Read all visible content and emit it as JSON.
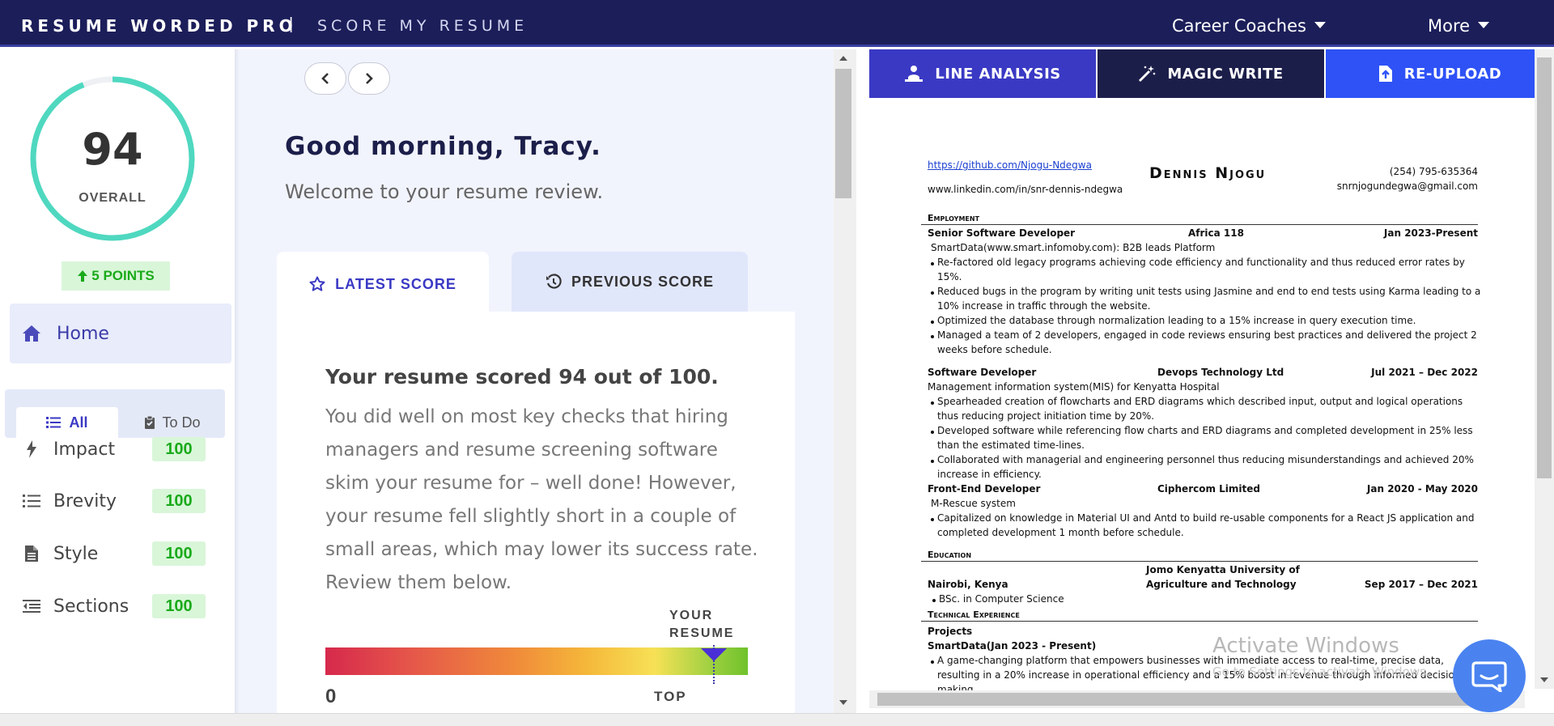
{
  "topbar": {
    "brand": "RESUME WORDED PRO",
    "separator": "|",
    "subtitle": "SCORE MY RESUME",
    "nav_career": "Career Coaches",
    "nav_more": "More"
  },
  "sidebar": {
    "score": "94",
    "score_label": "OVERALL",
    "score_progress": 0.94,
    "points": "5 POINTS",
    "home_label": "Home",
    "filter_all": "All",
    "filter_todo": "To Do",
    "categories": [
      {
        "label": "Impact",
        "score": "100",
        "icon": "lightning-icon"
      },
      {
        "label": "Brevity",
        "score": "100",
        "icon": "list-icon"
      },
      {
        "label": "Style",
        "score": "100",
        "icon": "document-icon"
      },
      {
        "label": "Sections",
        "score": "100",
        "icon": "sections-icon"
      }
    ]
  },
  "main": {
    "greeting": "Good morning, Tracy.",
    "welcome": "Welcome to your resume review.",
    "tab_latest": "LATEST SCORE",
    "tab_previous": "PREVIOUS SCORE",
    "card_title": "Your resume scored 94 out of 100.",
    "card_body": "You did well on most key checks that hiring managers and resume screening software skim your resume for – well done! However, your resume fell slightly short in a couple of small areas, which may lower its success rate. Review them below.",
    "your_resume_label_1": "YOUR",
    "your_resume_label_2": "RESUME",
    "bar_min": "0",
    "bar_top": "TOP",
    "bar_position": 0.92
  },
  "right": {
    "tab_line_analysis": "LINE ANALYSIS",
    "tab_magic_write": "MAGIC WRITE",
    "tab_reupload": "RE-UPLOAD",
    "colors": {
      "line_analysis": "#3a39c4",
      "magic_write": "#1c1e4a",
      "reupload": "#2e52f6"
    },
    "resume": {
      "github": "https://github.com/Njogu-Ndegwa",
      "linkedin": "www.linkedin.com/in/snr-dennis-ndegwa",
      "name": "Dennis Njogu",
      "phone": "(254) 795-635364",
      "email": "snrnjogundegwa@gmail.com",
      "employment_heading": "Employment",
      "job1_title": "Senior Software Developer",
      "job1_company": "Africa 118",
      "job1_dates": "Jan 2023-Present",
      "job1_sub": "SmartData(www.smart.infomoby.com): B2B leads Platform",
      "job1_b1a": "Re-factored old legacy programs achieving code efficiency and functionality and thus reduced error rates by",
      "job1_b1b": "15%.",
      "job1_b2a": "Reduced bugs in the program by writing unit tests using Jasmine and end to end tests using Karma leading to a",
      "job1_b2b": "10% increase in traffic through the website.",
      "job1_b3": "Optimized the database through normalization leading to a 15% increase in query execution time.",
      "job1_b4a": "Managed a team of 2 developers, engaged in code reviews ensuring best practices and delivered the project 2",
      "job1_b4b": "weeks before schedule.",
      "job2_title": "Software Developer",
      "job2_company": "Devops Technology Ltd",
      "job2_dates": "Jul 2021 – Dec 2022",
      "job2_sub": "Management information system(MIS) for Kenyatta Hospital",
      "job2_b1a": "Spearheaded creation of flowcharts and ERD diagrams which described input, output and logical operations",
      "job2_b1b": "thus reducing project initiation time by 20%.",
      "job2_b2a": "Developed software while referencing flow charts and ERD diagrams and completed development in 25% less",
      "job2_b2b": "than the estimated time-lines.",
      "job2_b3a": "Collaborated with managerial and engineering personnel thus reducing misunderstandings and achieved 20%",
      "job2_b3b": "increase in efficiency.",
      "job3_title": "Front-End Developer",
      "job3_company": "Ciphercom Limited",
      "job3_dates": "Jan 2020 - May 2020",
      "job3_sub": "M-Rescue system",
      "job3_b1a": "Capitalized on knowledge in Material UI and Antd to build re-usable components for a React JS application and",
      "job3_b1b": "completed development 1 month before schedule.",
      "education_heading": "Education",
      "edu_school_1": "Jomo Kenyatta University of",
      "edu_school_2": "Agriculture and Technology",
      "edu_location": "Nairobi, Kenya",
      "edu_dates": "Sep 2017 – Dec 2021",
      "edu_degree": "BSc. in Computer Science",
      "tech_heading": "Technical Experience",
      "projects_label": "Projects",
      "proj1_title": "SmartData(Jan 2023 - Present)",
      "proj1_b1a": "A game-changing platform that empowers businesses with immediate access to real-time, precise data,",
      "proj1_b1b": "resulting in a 20% increase in operational efficiency and a 15% boost in revenue through informed decision-",
      "proj1_b1c": "making."
    },
    "watermark_1": "Activate Windows",
    "watermark_2": "Go to Settings to activate Windows."
  }
}
